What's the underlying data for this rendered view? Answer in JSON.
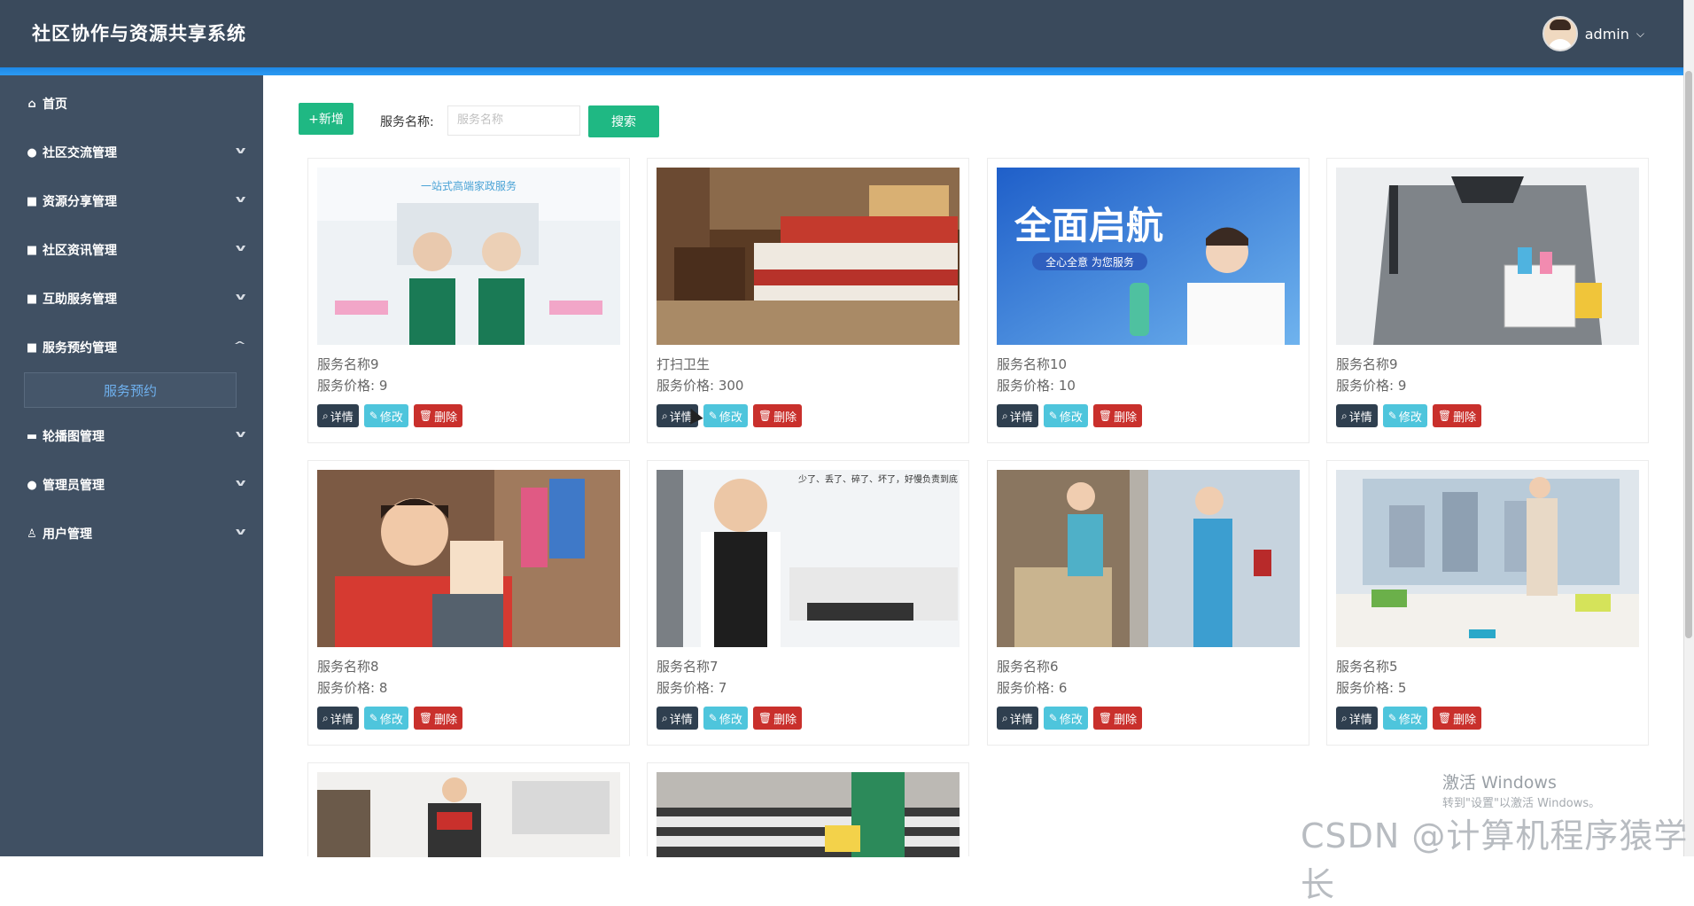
{
  "header": {
    "title": "社区协作与资源共享系统",
    "username": "admin"
  },
  "sidebar": {
    "items": [
      {
        "label": "首页",
        "icon": "home-icon"
      },
      {
        "label": "社区交流管理",
        "icon": "drop-icon"
      },
      {
        "label": "资源分享管理",
        "icon": "box-icon"
      },
      {
        "label": "社区资讯管理",
        "icon": "box-icon"
      },
      {
        "label": "互助服务管理",
        "icon": "box-icon"
      },
      {
        "label": "服务预约管理",
        "icon": "box-icon",
        "expanded": true
      },
      {
        "label": "轮播图管理",
        "icon": "image-icon"
      },
      {
        "label": "管理员管理",
        "icon": "user-icon"
      },
      {
        "label": "用户管理",
        "icon": "user-icon"
      }
    ],
    "submenu": {
      "label": "服务预约"
    }
  },
  "toolbar": {
    "add_label": "+新增",
    "search_label": "服务名称:",
    "search_placeholder": "服务名称",
    "search_button": "搜索"
  },
  "actions": {
    "detail": "详情",
    "edit": "修改",
    "delete": "删除"
  },
  "cards": [
    {
      "name": "服务名称9",
      "price": "服务价格:  9",
      "theme": "cleaning-pair"
    },
    {
      "name": "打扫卫生",
      "price": "服务价格:  300",
      "theme": "hotel-room"
    },
    {
      "name": "服务名称10",
      "price": "服务价格:  10",
      "theme": "blue-banner"
    },
    {
      "name": "服务名称9",
      "price": "服务价格:  9",
      "theme": "cleaner-bucket"
    },
    {
      "name": "服务名称8",
      "price": "服务价格:  8",
      "theme": "red-glove"
    },
    {
      "name": "服务名称7",
      "price": "服务价格:  7",
      "theme": "living-room"
    },
    {
      "name": "服务名称6",
      "price": "服务价格:  6",
      "theme": "sofa-clean"
    },
    {
      "name": "服务名称5",
      "price": "服务价格:  5",
      "theme": "mop-floor"
    },
    {
      "name": "",
      "price": "",
      "theme": "kitchen"
    },
    {
      "name": "",
      "price": "",
      "theme": "fabric"
    }
  ],
  "banner_texts": {
    "card1": "一站式高端家政服务",
    "card3_big": "全面启航",
    "card3_small": "全心全意 为您服务",
    "card6": "少了、丢了、碎了、坏了，好慢负责到底"
  },
  "watermark": {
    "line1": "激活 Windows",
    "line2": "转到\"设置\"以激活 Windows。",
    "csdn": "CSDN @计算机程序猿学长"
  }
}
